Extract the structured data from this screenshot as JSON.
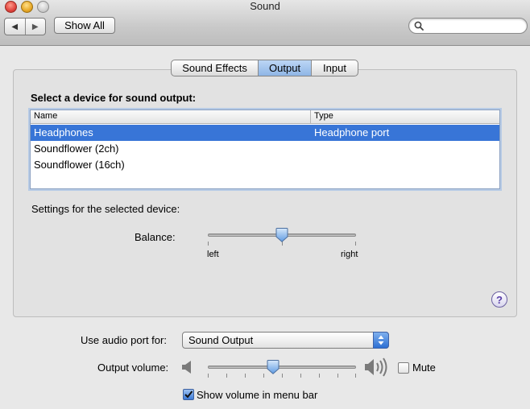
{
  "window": {
    "title": "Sound"
  },
  "toolbar": {
    "show_all_label": "Show All",
    "search_placeholder": ""
  },
  "tabs": [
    {
      "label": "Sound Effects",
      "active": false
    },
    {
      "label": "Output",
      "active": true
    },
    {
      "label": "Input",
      "active": false
    }
  ],
  "output": {
    "section_title": "Select a device for sound output:",
    "columns": [
      "Name",
      "Type"
    ],
    "devices": [
      {
        "name": "Headphones",
        "type": "Headphone port",
        "selected": true
      },
      {
        "name": "Soundflower (2ch)",
        "type": "",
        "selected": false
      },
      {
        "name": "Soundflower (16ch)",
        "type": "",
        "selected": false
      }
    ],
    "settings_label": "Settings for the selected device:",
    "balance": {
      "label": "Balance:",
      "left_label": "left",
      "right_label": "right",
      "value": 0.5
    }
  },
  "bottom": {
    "port_label": "Use audio port for:",
    "port_value": "Sound Output",
    "volume_label": "Output volume:",
    "volume_value": 0.44,
    "mute_label": "Mute",
    "mute_checked": false,
    "menu_bar_label": "Show volume in menu bar",
    "menu_bar_checked": true
  },
  "colors": {
    "selection": "#3875d7",
    "accent": "#2d6fd3"
  }
}
